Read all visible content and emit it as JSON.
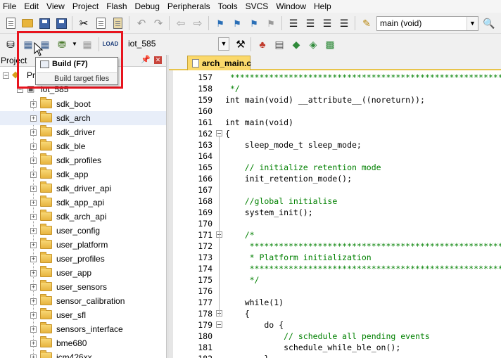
{
  "menu": [
    "File",
    "Edit",
    "View",
    "Project",
    "Flash",
    "Debug",
    "Peripherals",
    "Tools",
    "SVCS",
    "Window",
    "Help"
  ],
  "toolbar": {
    "function_combo": "main (void)",
    "target_combo": "iot_585"
  },
  "project_panel": {
    "title": "Project",
    "root_prefix": "Pr",
    "target_name": "iot_585",
    "groups": [
      "sdk_boot",
      "sdk_arch",
      "sdk_driver",
      "sdk_ble",
      "sdk_profiles",
      "sdk_app",
      "sdk_driver_api",
      "sdk_app_api",
      "sdk_arch_api",
      "user_config",
      "user_platform",
      "user_profiles",
      "user_app",
      "user_sensors",
      "sensor_calibration",
      "user_sfl",
      "sensors_interface",
      "bme680",
      "icm426xx"
    ],
    "selected_group": "sdk_arch"
  },
  "editor": {
    "tab_label": "arch_main.c",
    "lines": [
      {
        "n": "157",
        "t": " ************************************************************",
        "c": "cm"
      },
      {
        "n": "158",
        "t": " */",
        "c": "cm"
      },
      {
        "n": "159",
        "t": "int main(void) __attribute__((noreturn));",
        "c": "mix1"
      },
      {
        "n": "160",
        "t": "",
        "c": "nm"
      },
      {
        "n": "161",
        "t": "int main(void)",
        "c": "mix2"
      },
      {
        "n": "162",
        "t": "{",
        "c": "nm"
      },
      {
        "n": "163",
        "t": "    sleep_mode_t sleep_mode;",
        "c": "nm"
      },
      {
        "n": "164",
        "t": "",
        "c": "nm"
      },
      {
        "n": "165",
        "t": "    // initialize retention mode",
        "c": "cm"
      },
      {
        "n": "166",
        "t": "    init_retention_mode();",
        "c": "nm"
      },
      {
        "n": "167",
        "t": "",
        "c": "nm"
      },
      {
        "n": "168",
        "t": "    //global initialise",
        "c": "cm"
      },
      {
        "n": "169",
        "t": "    system_init();",
        "c": "nm"
      },
      {
        "n": "170",
        "t": "",
        "c": "nm"
      },
      {
        "n": "171",
        "t": "    /*",
        "c": "cm"
      },
      {
        "n": "172",
        "t": "     ********************************************************",
        "c": "cm"
      },
      {
        "n": "173",
        "t": "     * Platform initialization",
        "c": "cm"
      },
      {
        "n": "174",
        "t": "     ********************************************************",
        "c": "cm"
      },
      {
        "n": "175",
        "t": "     */",
        "c": "cm"
      },
      {
        "n": "176",
        "t": "",
        "c": "nm"
      },
      {
        "n": "177",
        "t": "    while(1)",
        "c": "mix3"
      },
      {
        "n": "178",
        "t": "    {",
        "c": "nm"
      },
      {
        "n": "179",
        "t": "        do {",
        "c": "mix4"
      },
      {
        "n": "180",
        "t": "            // schedule all pending events",
        "c": "cm"
      },
      {
        "n": "181",
        "t": "            schedule_while_ble_on();",
        "c": "nm"
      },
      {
        "n": "182",
        "t": "        }",
        "c": "nm"
      }
    ]
  },
  "tooltip": {
    "title": "Build (F7)",
    "description": "Build target files"
  },
  "colors": {
    "highlight": "#e8141e",
    "tab_active": "#fbd96b",
    "comment": "#008000",
    "keyword": "#0000ff"
  }
}
